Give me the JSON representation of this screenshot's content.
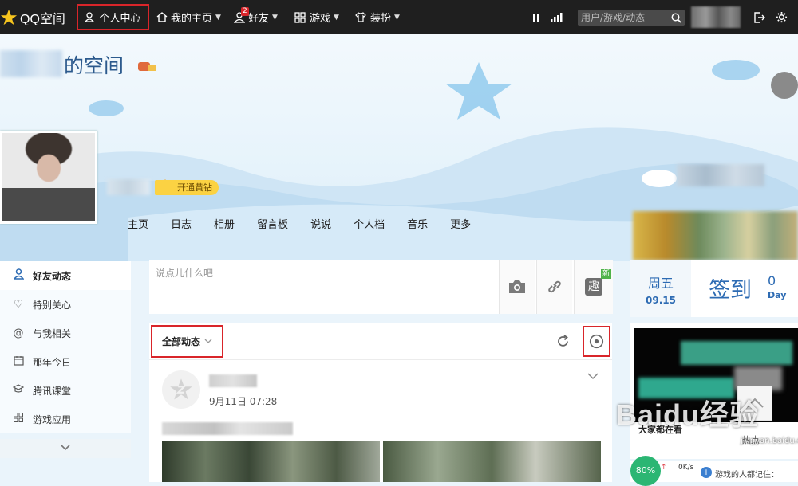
{
  "topbar": {
    "brand": "QQ空间",
    "personal_center": "个人中心",
    "my_home": "我的主页",
    "friends": "好友",
    "friends_badge": "2",
    "games": "游戏",
    "dress_up": "装扮",
    "search_placeholder": "用户/游戏/动态"
  },
  "header": {
    "space_title": "的空间",
    "vip_button": "开通黄钻",
    "nav": [
      "主页",
      "日志",
      "相册",
      "留言板",
      "说说",
      "个人档",
      "音乐",
      "更多"
    ]
  },
  "sidebar": {
    "items": [
      {
        "label": "好友动态",
        "icon": "person-icon",
        "active": true
      },
      {
        "label": "特别关心",
        "icon": "heart-icon",
        "active": false
      },
      {
        "label": "与我相关",
        "icon": "at-icon",
        "active": false
      },
      {
        "label": "那年今日",
        "icon": "calendar-icon",
        "active": false
      },
      {
        "label": "腾讯课堂",
        "icon": "graduation-icon",
        "active": false
      },
      {
        "label": "游戏应用",
        "icon": "grid-icon",
        "active": false
      }
    ]
  },
  "composer": {
    "placeholder": "说点儿什么吧",
    "fun_label": "趣",
    "new_tag": "新"
  },
  "feed": {
    "filter_label": "全部动态",
    "post_time": "9月11日 07:28"
  },
  "checkin": {
    "weekday": "周五",
    "date": "09.15",
    "label": "签到",
    "days": "0",
    "days_unit": "Day"
  },
  "video": {
    "caption": "大家都在看"
  },
  "side_label": "热点",
  "netbar": {
    "percent": "80%",
    "speed": "0K/s",
    "text": "游戏的人都记住："
  },
  "watermark": {
    "text": "Baidu经验",
    "sub": "jingyan.baidu.com"
  },
  "colors": {
    "topbar_bg": "#1f1f1f",
    "accent_blue": "#2d6bb3",
    "highlight_red": "#d9252a",
    "vip_yellow": "#fbd243"
  }
}
